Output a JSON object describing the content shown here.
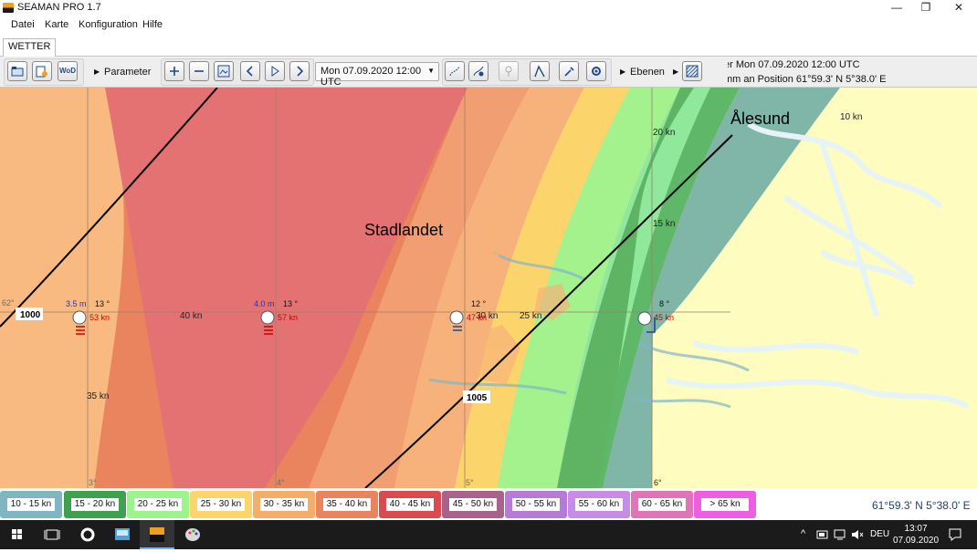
{
  "window": {
    "title": "SEAMAN PRO  1.7",
    "controls": [
      "—",
      "❐",
      "✕"
    ]
  },
  "menu": [
    "Datei",
    "Karte",
    "Konfiguration",
    "Hilfe"
  ],
  "tab": "WETTER",
  "toolbar": {
    "wod_label": "WoD",
    "parameter_label": "Parameter",
    "time_value": "Mon 07.09.2020 12:00 UTC",
    "ebenen_label": "Ebenen"
  },
  "info": {
    "line1": "er Mon 07.09.2020 12:00 UTC",
    "line2": "mm an Position 61°59.3' N 5°38.0' E"
  },
  "map": {
    "places": {
      "alesund": "Ålesund",
      "stadlandet": "Stadlandet"
    },
    "isobars": [
      "1000",
      "1005"
    ],
    "contour_labels": [
      "10 kn",
      "20 kn",
      "15 kn",
      "40 kn",
      "35 kn",
      "30 kn",
      "25 kn"
    ],
    "grid_labels": [
      "62°",
      "3°",
      "4°",
      "5°",
      "6°"
    ],
    "stations": [
      {
        "wave": "3.5 m",
        "temp": "13 °",
        "wind": "53 kn"
      },
      {
        "wave": "4.0 m",
        "temp": "13 °",
        "wind": "57 kn"
      },
      {
        "wave": "",
        "temp": "12 °",
        "wind": "47 kn"
      },
      {
        "wave": "",
        "temp": "8 °",
        "wind": "45 kn"
      }
    ]
  },
  "legend": [
    {
      "label": "10 - 15 kn",
      "color": "#7fb6c1"
    },
    {
      "label": "15 - 20 kn",
      "color": "#3fa14f"
    },
    {
      "label": "20 - 25 kn",
      "color": "#9df38c"
    },
    {
      "label": "25 - 30 kn",
      "color": "#fbd56c"
    },
    {
      "label": "30 - 35 kn",
      "color": "#f4ae69"
    },
    {
      "label": "35 - 40 kn",
      "color": "#e9845e"
    },
    {
      "label": "40 - 45 kn",
      "color": "#da4a4e"
    },
    {
      "label": "45 - 50 kn",
      "color": "#a8628c"
    },
    {
      "label": "50 - 55 kn",
      "color": "#b57bd6"
    },
    {
      "label": "55 - 60 kn",
      "color": "#c88be6"
    },
    {
      "label": "60 - 65 kn",
      "color": "#df74b8"
    },
    {
      "label": "> 65 kn",
      "color": "#ee5ee2"
    }
  ],
  "status": {
    "coords": "61°59.3' N 5°38.0' E"
  },
  "taskbar": {
    "lang": "DEU",
    "time": "13:07",
    "date": "07.09.2020"
  }
}
